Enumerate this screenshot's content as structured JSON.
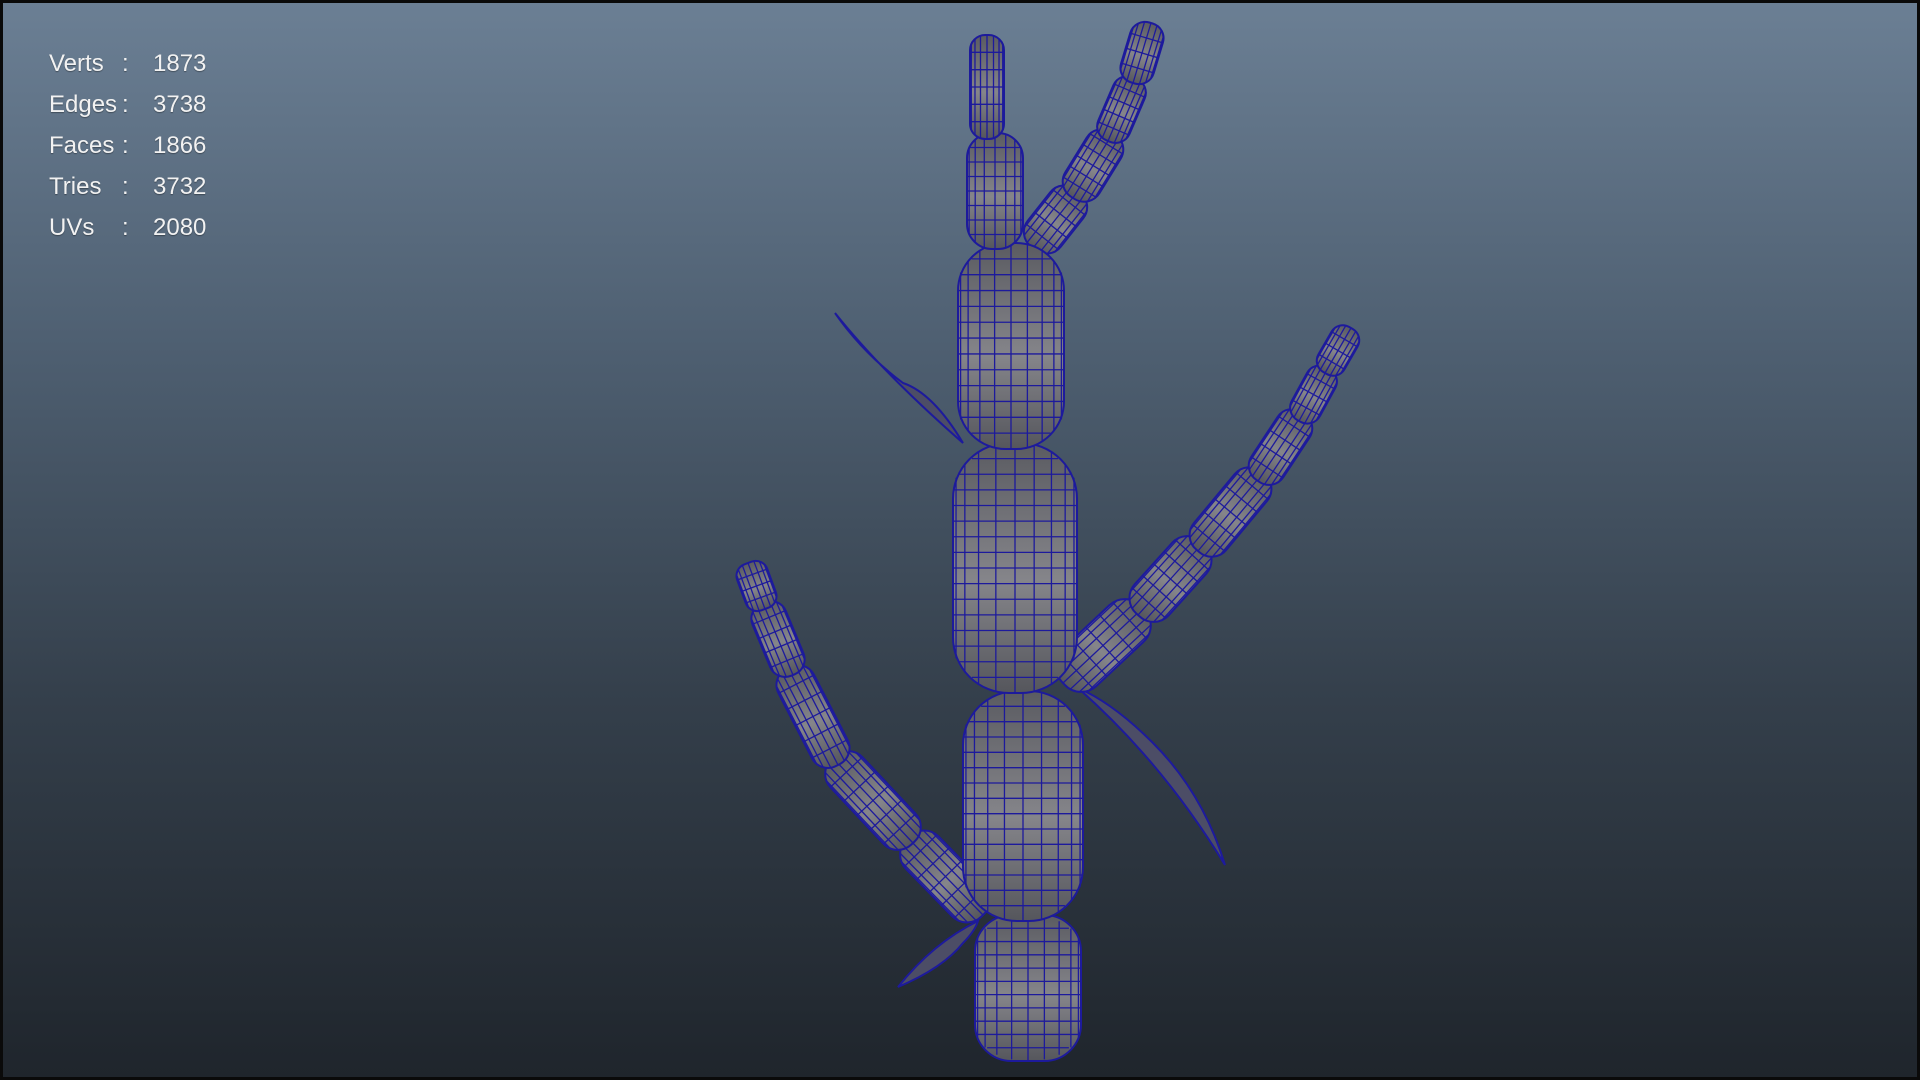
{
  "viewport": {
    "background_top": "#6b7f94",
    "background_bottom": "#1f252c",
    "wire_color": "#1d1a9c",
    "shade_color": "#7c7c80"
  },
  "hud": {
    "rows": [
      {
        "label": "Verts",
        "colon": ":",
        "value": "1873"
      },
      {
        "label": "Edges",
        "colon": ":",
        "value": "3738"
      },
      {
        "label": "Faces",
        "colon": ":",
        "value": "1866"
      },
      {
        "label": "Tries",
        "colon": ":",
        "value": "3732"
      },
      {
        "label": "UVs",
        "colon": ":",
        "value": "2080"
      }
    ]
  },
  "model": {
    "type": "wireframe-on-shaded",
    "name_icon": "plant-stem-mesh"
  }
}
